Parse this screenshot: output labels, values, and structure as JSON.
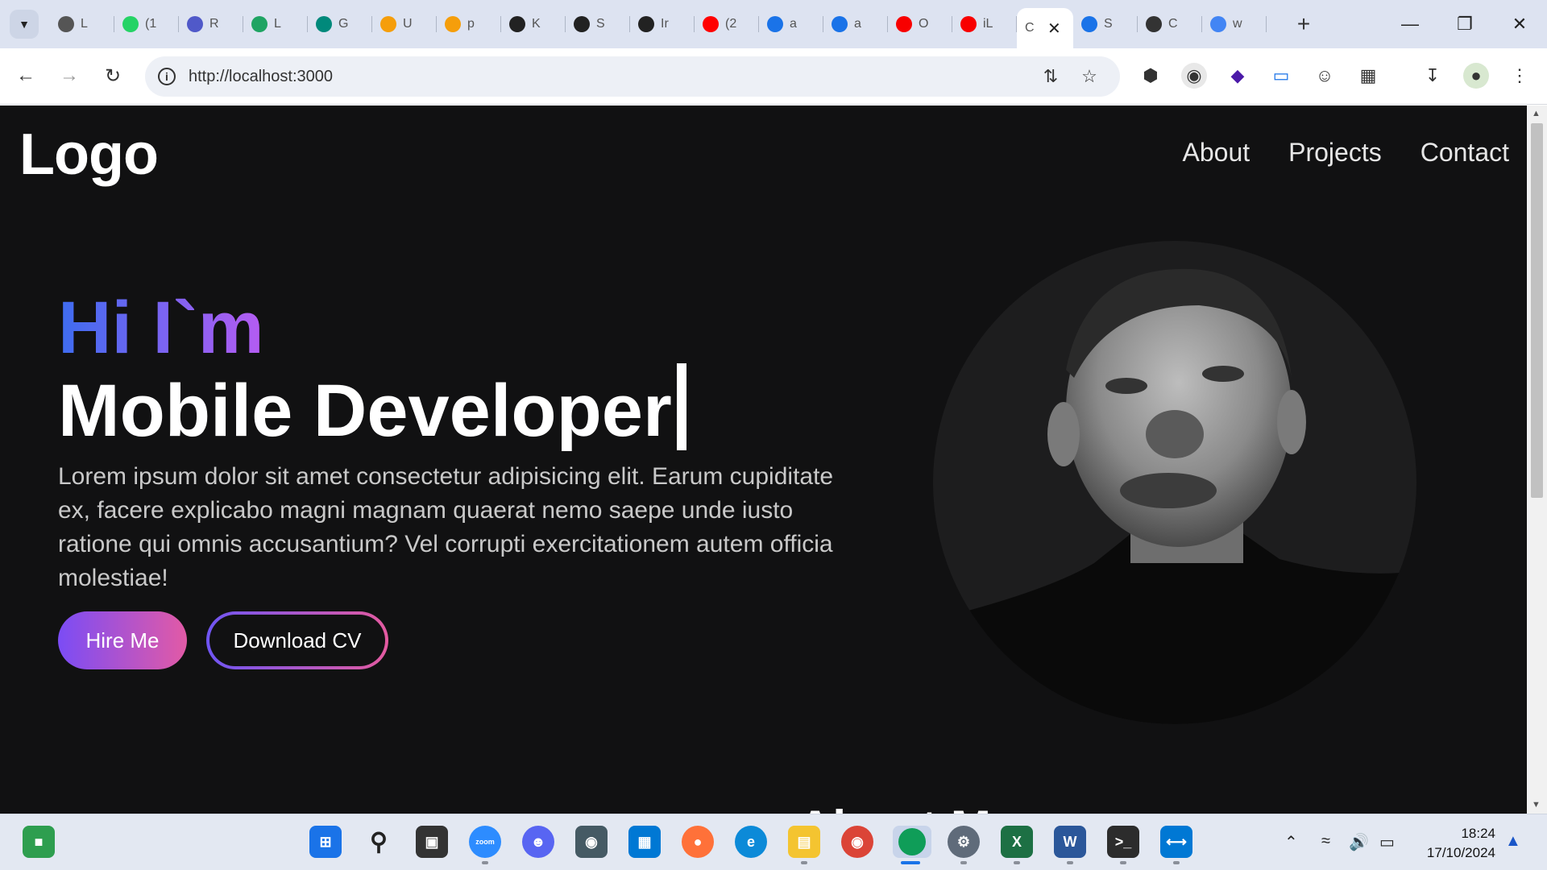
{
  "tabs": [
    {
      "label": "L",
      "color": "#555555"
    },
    {
      "label": "(1",
      "color": "#25d366"
    },
    {
      "label": "R",
      "color": "#5059c9"
    },
    {
      "label": "L",
      "color": "#1fa463"
    },
    {
      "label": "G",
      "color": "#00897b"
    },
    {
      "label": "U",
      "color": "#f59e0b"
    },
    {
      "label": "p",
      "color": "#f59e0b"
    },
    {
      "label": "K",
      "color": "#222222"
    },
    {
      "label": "S",
      "color": "#222222"
    },
    {
      "label": "Ir",
      "color": "#222222"
    },
    {
      "label": "(2",
      "color": "#ff0000"
    },
    {
      "label": "a",
      "color": "#1a73e8"
    },
    {
      "label": "a",
      "color": "#1a73e8"
    },
    {
      "label": "O",
      "color": "#f80000"
    },
    {
      "label": "iL",
      "color": "#f80000"
    },
    {
      "label": "C",
      "color": "#444444",
      "active": true
    },
    {
      "label": "S",
      "color": "#1a73e8"
    },
    {
      "label": "C",
      "color": "#333333"
    },
    {
      "label": "w",
      "color": "#4285f4"
    }
  ],
  "address": {
    "url": "http://localhost:3000"
  },
  "site": {
    "logo": "Logo",
    "nav": [
      "About",
      "Projects",
      "Contact"
    ],
    "greeting": "Hi I`m",
    "role": "Mobile Developer",
    "description": "Lorem ipsum dolor sit amet consectetur adipisicing elit. Earum cupiditate ex, facere explicabo magni magnam quaerat nemo saepe unde iusto ratione qui omnis accusantium? Vel corrupti exercitationem autem officia molestiae!",
    "hire_label": "Hire Me",
    "cv_label": "Download CV",
    "next_heading": "About Me"
  },
  "taskbar": {
    "time": "18:24",
    "date": "17/10/2024"
  },
  "colors": {
    "page_bg": "#111112",
    "accent_blue": "#3d6cf0",
    "accent_purple": "#b65cf2",
    "accent_pink": "#e25aa6"
  }
}
